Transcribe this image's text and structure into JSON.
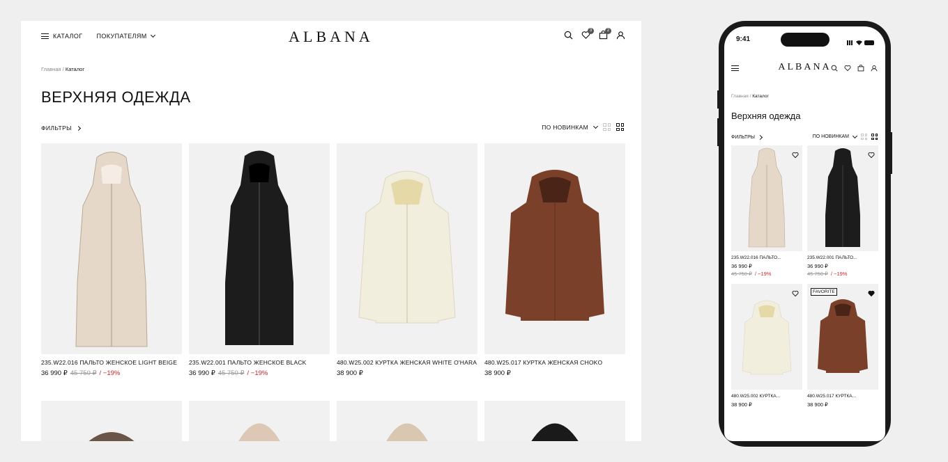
{
  "desktop": {
    "nav": {
      "catalog": "КАТАЛОГ",
      "buyers": "ПОКУПАТЕЛЯМ"
    },
    "logo": "ALBANA",
    "badges": {
      "favorites": "3",
      "cart": "2"
    },
    "breadcrumb": {
      "home": "Главная",
      "sep": "/",
      "current": "Каталог"
    },
    "title": "ВЕРХНЯЯ ОДЕЖДА",
    "filters": "ФИЛЬТРЫ",
    "sort": "ПО НОВИНКАМ",
    "products": [
      {
        "name": "235.W22.016 ПАЛЬТО ЖЕНСКОЕ LIGHT BEIGE",
        "price": "36 990 ₽",
        "old_price": "45 750 ₽",
        "discount": "/  −19%",
        "color": "#e6d8c8"
      },
      {
        "name": "235.W22.001 ПАЛЬТО ЖЕНСКОЕ BLACK",
        "price": "36 990 ₽",
        "old_price": "45 750 ₽",
        "discount": "/  −19%",
        "color": "#1c1c1c"
      },
      {
        "name": "480.W25.002 КУРТКА ЖЕНСКАЯ WHITE O'HARA",
        "price": "38 900 ₽",
        "old_price": "",
        "discount": "",
        "color": "#f2eedd"
      },
      {
        "name": "480.W25.017 КУРТКА ЖЕНСКАЯ CHOKO",
        "price": "38 900 ₽",
        "old_price": "",
        "discount": "",
        "color": "#7a402a"
      }
    ],
    "row2_colors": [
      "#6b5548",
      "#ddc8b5",
      "#d9c7b2",
      "#1a1a1a"
    ]
  },
  "phone": {
    "time": "9:41",
    "logo": "ALBANA",
    "breadcrumb": {
      "home": "Главная",
      "sep": "/",
      "current": "Каталог"
    },
    "title": "Верхняя одежда",
    "filters": "ФИЛЬТРЫ",
    "sort": "ПО НОВИНКАМ",
    "products": [
      {
        "name": "235.W22.016 ПАЛЬТО...",
        "price": "36 990 ₽",
        "old_price": "45 750 ₽",
        "discount": "/ −19%",
        "color": "#e6d8c8",
        "tag": "",
        "favorite": false
      },
      {
        "name": "235.W22.001 ПАЛЬТО...",
        "price": "36 990 ₽",
        "old_price": "45 750 ₽",
        "discount": "/ −19%",
        "color": "#1c1c1c",
        "tag": "",
        "favorite": false
      },
      {
        "name": "480.W25.002 КУРТКА...",
        "price": "38 900 ₽",
        "old_price": "",
        "discount": "",
        "color": "#f2eedd",
        "tag": "",
        "favorite": false
      },
      {
        "name": "480.W25.017 КУРТКА...",
        "price": "38 900 ₽",
        "old_price": "",
        "discount": "",
        "color": "#7a402a",
        "tag": "FAVORITE",
        "favorite": true
      }
    ]
  }
}
